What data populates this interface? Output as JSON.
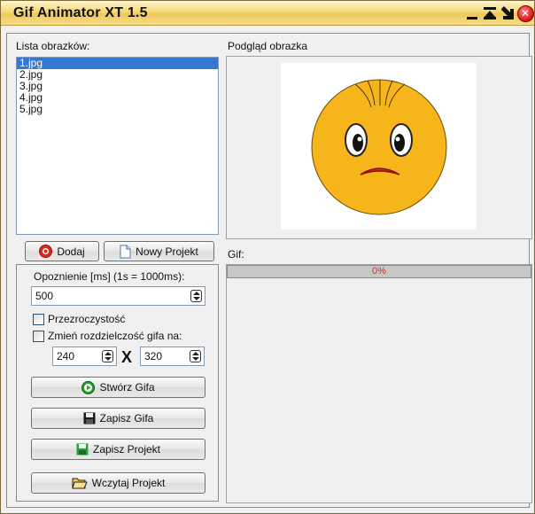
{
  "window": {
    "title": "Gif Animator XT 1.5",
    "minimize_glyph": "_",
    "restore_glyph": "▲",
    "arrow_glyph": "↘",
    "close_glyph": "✕"
  },
  "images_panel": {
    "label": "Lista obrazków:",
    "items": [
      {
        "label": "1.jpg",
        "selected": true
      },
      {
        "label": "2.jpg",
        "selected": false
      },
      {
        "label": "3.jpg",
        "selected": false
      },
      {
        "label": "4.jpg",
        "selected": false
      },
      {
        "label": "5.jpg",
        "selected": false
      }
    ]
  },
  "preview": {
    "label": "Podgląd obrazka",
    "image": "sad-face-emoticon"
  },
  "buttons": {
    "add_label": "Dodaj",
    "add_icon": "red-circle-plus-icon",
    "new_project_label": "Nowy Projekt",
    "new_project_icon": "blank-document-icon"
  },
  "settings": {
    "delay_label": "Opoznienie [ms] (1s = 1000ms):",
    "delay_value": "500",
    "transparency_label": "Przezroczystość",
    "transparency_checked": false,
    "resize_label": "Zmień rozdzielczość gifa na:",
    "resize_checked": false,
    "width_value": "240",
    "height_value": "320",
    "times_glyph": "X",
    "create_gif_label": "Stwórz Gifa",
    "save_gif_label": "Zapisz Gifa",
    "save_project_label": "Zapisz Projekt",
    "load_project_label": "Wczytaj Projekt"
  },
  "gif_panel": {
    "label": "Gif:",
    "progress_percent": 0,
    "progress_text": "0%"
  },
  "colors": {
    "titlebar": "#f7d778",
    "selection": "#3478d4",
    "face": "#f7b51c",
    "progress_text": "#c03030"
  }
}
